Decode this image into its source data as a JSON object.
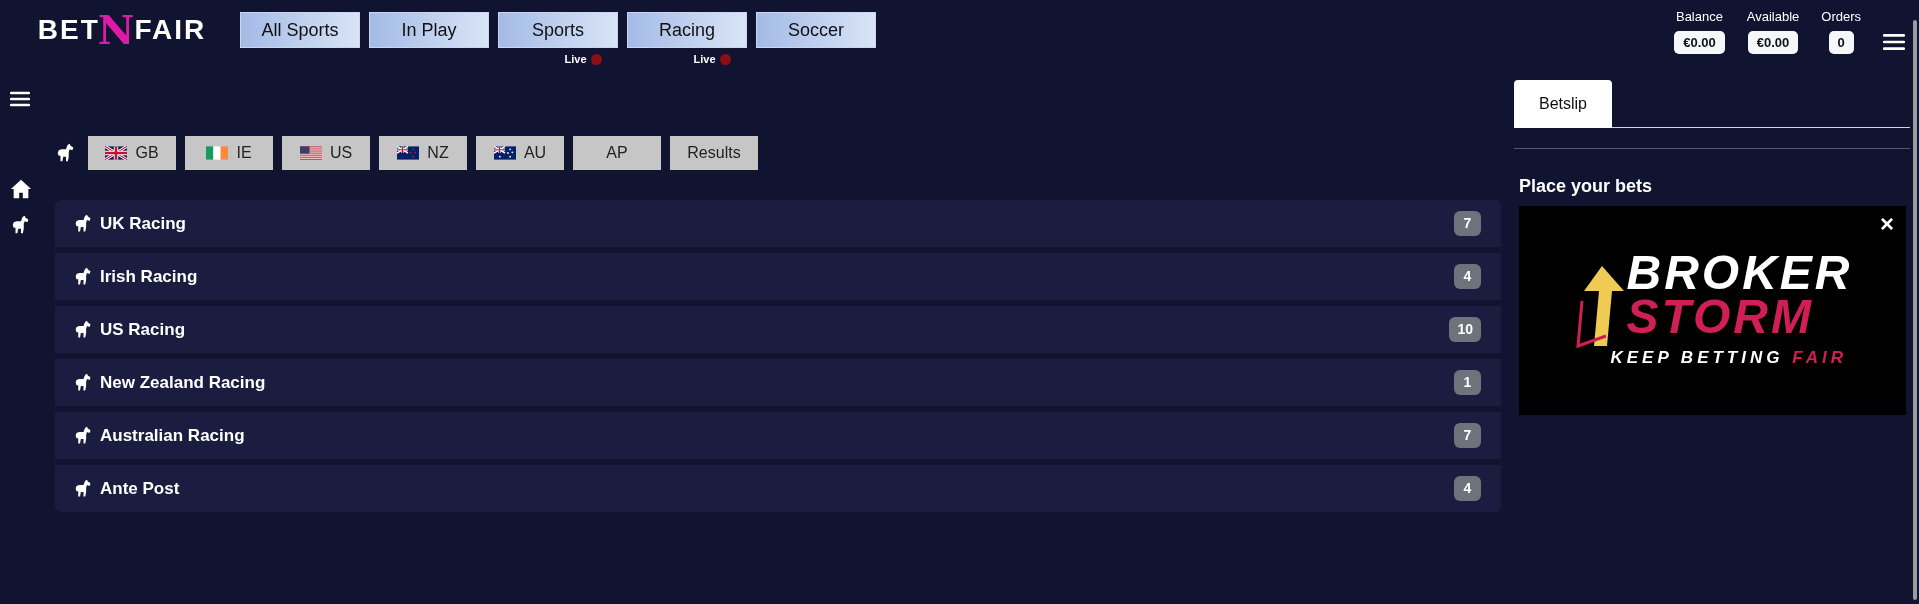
{
  "logo": {
    "left": "BET",
    "middle": "N",
    "right": "FAIR"
  },
  "nav": [
    {
      "label": "All Sports",
      "live": false
    },
    {
      "label": "In Play",
      "live": false
    },
    {
      "label": "Sports",
      "live": true,
      "live_label": "Live"
    },
    {
      "label": "Racing",
      "live": true,
      "live_label": "Live"
    },
    {
      "label": "Soccer",
      "live": false
    }
  ],
  "account": [
    {
      "label": "Balance",
      "value": "€0.00"
    },
    {
      "label": "Available",
      "value": "€0.00"
    },
    {
      "label": "Orders",
      "value": "0"
    }
  ],
  "region_tabs": [
    {
      "label": "GB",
      "kind": "gb"
    },
    {
      "label": "IE",
      "kind": "ie"
    },
    {
      "label": "US",
      "kind": "us"
    },
    {
      "label": "NZ",
      "kind": "nz"
    },
    {
      "label": "AU",
      "kind": "au"
    },
    {
      "label": "AP",
      "kind": "plain"
    },
    {
      "label": "Results",
      "kind": "plain"
    }
  ],
  "meetings": [
    {
      "name": "UK Racing",
      "count": "7"
    },
    {
      "name": "Irish Racing",
      "count": "4"
    },
    {
      "name": "US Racing",
      "count": "10"
    },
    {
      "name": "New Zealand Racing",
      "count": "1"
    },
    {
      "name": "Australian Racing",
      "count": "7"
    },
    {
      "name": "Ante Post",
      "count": "4"
    }
  ],
  "betslip": {
    "tab": "Betslip",
    "heading": "Place your bets",
    "banner": {
      "line1": "BROKER",
      "line2": "STORM",
      "tagline": "KEEP BETTING",
      "tagline_accent": "FAIR",
      "close": "×"
    }
  }
}
